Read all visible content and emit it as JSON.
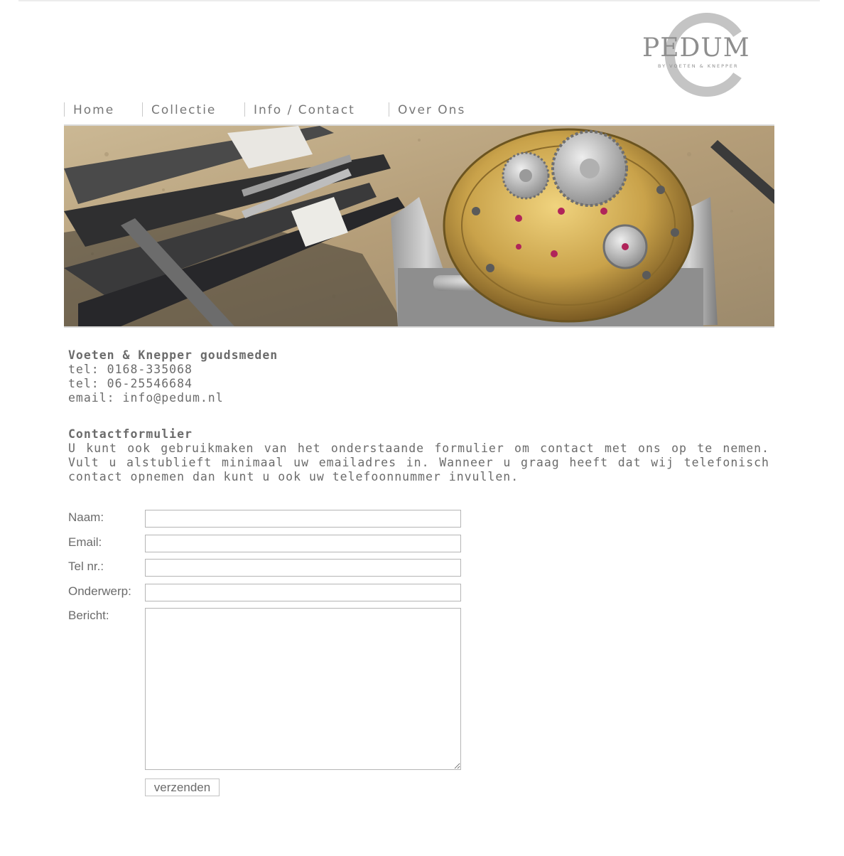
{
  "logo": {
    "word": "PEDUM",
    "subtitle": "BY VOETEN & KNEPPER"
  },
  "nav": {
    "items": [
      {
        "label": "Home"
      },
      {
        "label": "Collectie"
      },
      {
        "label": "Info / Contact"
      },
      {
        "label": "Over Ons"
      }
    ]
  },
  "hero": {
    "icon": "watch-movement-photo"
  },
  "contact": {
    "company": "Voeten & Knepper goudsmeden",
    "phone1": "tel: 0168-335068",
    "phone2": "tel: 06-25546684",
    "email": "email: info@pedum.nl"
  },
  "form_intro": {
    "title": "Contactformulier",
    "text": "U kunt ook gebruikmaken van het onderstaande formulier om contact met ons op te nemen. Vult u alstublieft minimaal uw emailadres in. Wanneer u graag heeft dat wij telefonisch contact opnemen dan kunt u ook uw telefoonnummer invullen."
  },
  "form": {
    "name_label": "Naam:",
    "name_value": "",
    "email_label": "Email:",
    "email_value": "",
    "phone_label": "Tel nr.:",
    "phone_value": "",
    "subject_label": "Onderwerp:",
    "subject_value": "",
    "message_label": "Bericht:",
    "message_value": "",
    "submit_label": "verzenden"
  },
  "colors": {
    "text": "#6b6b6b",
    "logo_gray": "#8e8e8e",
    "logo_ring": "#c4c4c4",
    "gold": "#c9a24a"
  }
}
